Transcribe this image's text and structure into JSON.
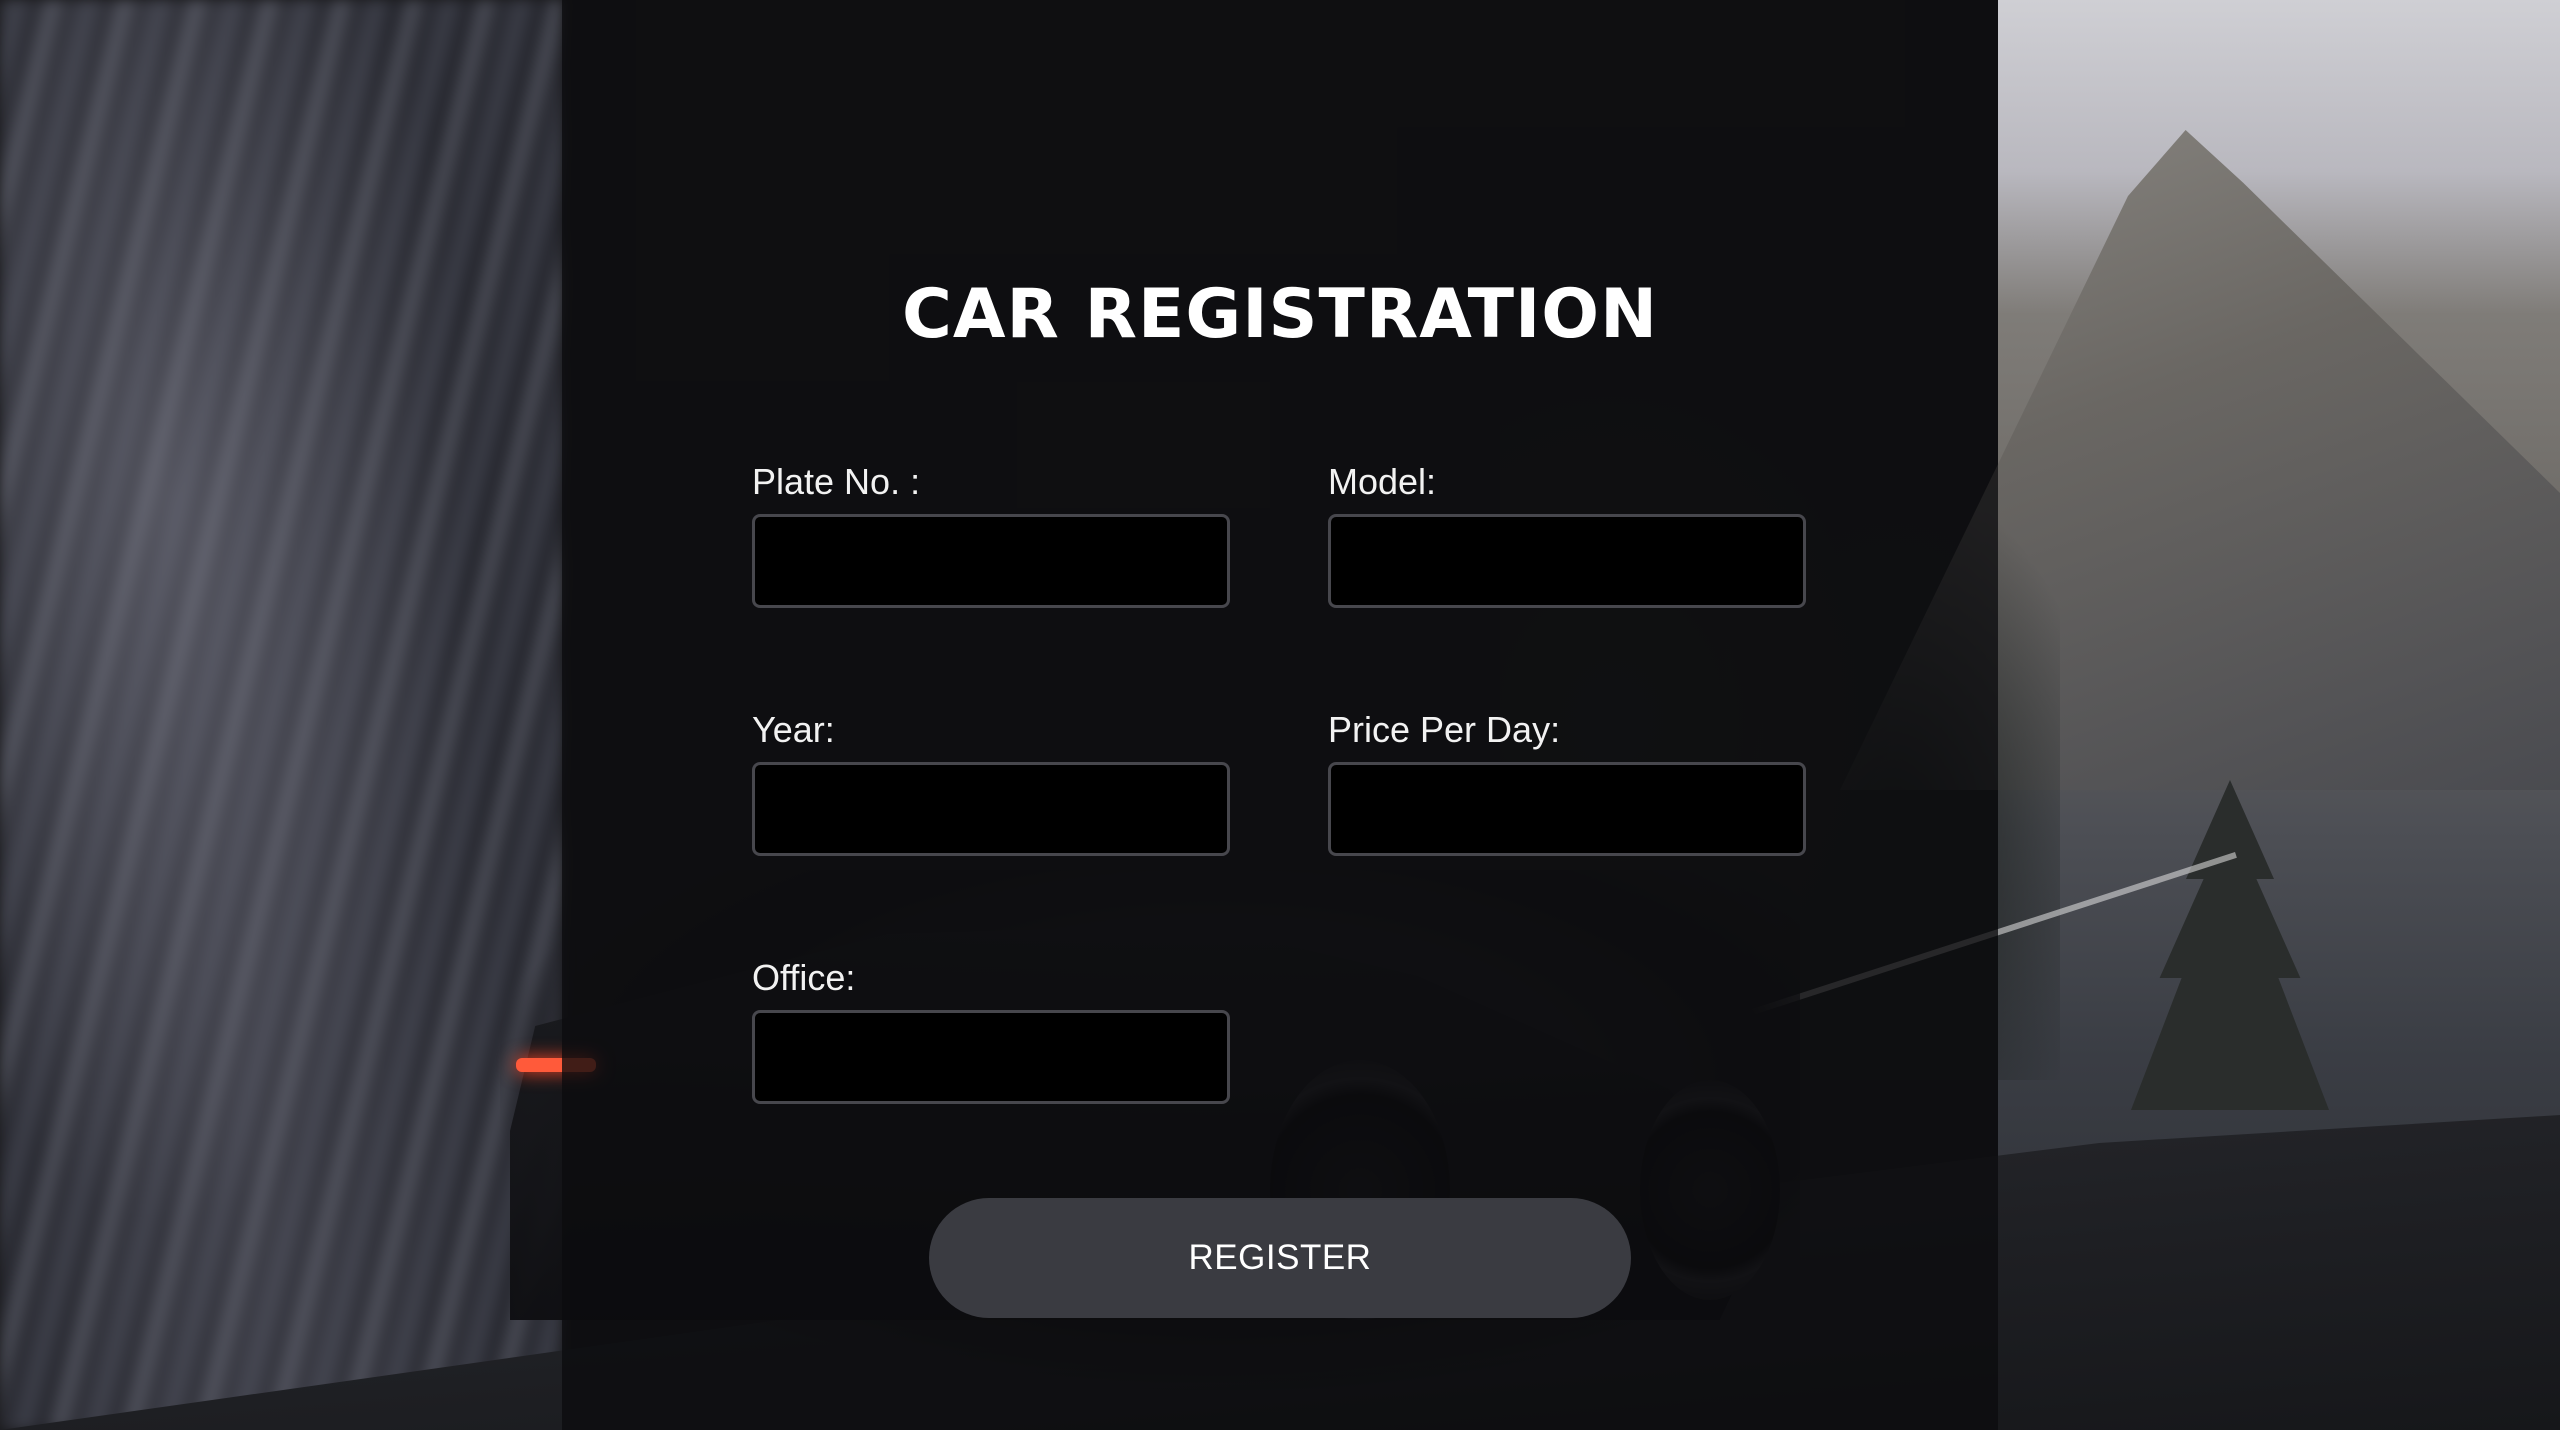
{
  "form": {
    "title": "CAR REGISTRATION",
    "fields": [
      {
        "label": "Plate No. :",
        "value": "",
        "placeholder": ""
      },
      {
        "label": "Model:",
        "value": "",
        "placeholder": ""
      },
      {
        "label": "Year:",
        "value": "",
        "placeholder": ""
      },
      {
        "label": "Price Per Day:",
        "value": "",
        "placeholder": ""
      },
      {
        "label": "Office:",
        "value": "",
        "placeholder": ""
      }
    ],
    "submit_label": "REGISTER"
  },
  "colors": {
    "overlay": "#0c0c0e",
    "input_background": "#000000",
    "input_border": "#47474d",
    "button_background": "#3a3b41",
    "text": "#ffffff"
  }
}
